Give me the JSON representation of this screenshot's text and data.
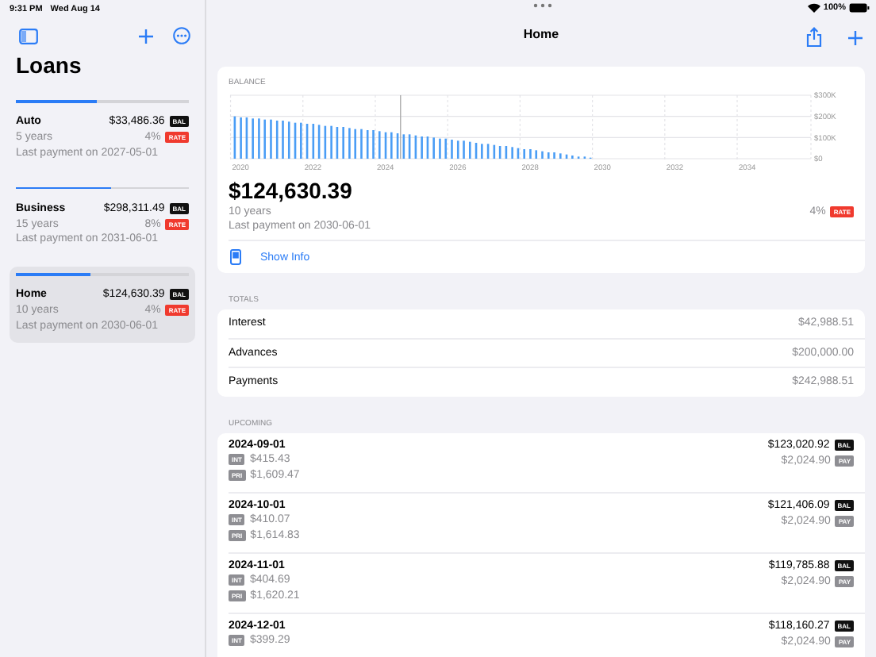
{
  "status_bar": {
    "time": "9:31 PM",
    "date": "Wed Aug 14",
    "battery": "100%"
  },
  "sidebar": {
    "title": "Loans",
    "loans": [
      {
        "name": "Auto",
        "balance": "$33,486.36",
        "balance_badge": "BAL",
        "term": "5 years",
        "rate": "4%",
        "rate_badge": "RATE",
        "last_payment": "Last payment on 2027-05-01",
        "level": 0.47,
        "selected": false
      },
      {
        "name": "Business",
        "balance": "$298,311.49",
        "balance_badge": "BAL",
        "term": "15 years",
        "rate": "8%",
        "rate_badge": "RATE",
        "last_payment": "Last payment on 2031-06-01",
        "level": 0.55,
        "selected": false
      },
      {
        "name": "Home",
        "balance": "$124,630.39",
        "balance_badge": "BAL",
        "term": "10 years",
        "rate": "4%",
        "rate_badge": "RATE",
        "last_payment": "Last payment on 2030-06-01",
        "level": 0.43,
        "selected": true
      }
    ]
  },
  "detail": {
    "title": "Home",
    "balance_card": {
      "label": "BALANCE",
      "chart_data": {
        "type": "bar",
        "x": [
          2020,
          2020.17,
          2020.33,
          2020.5,
          2020.67,
          2020.83,
          2021,
          2021.17,
          2021.33,
          2021.5,
          2021.67,
          2021.83,
          2022,
          2022.17,
          2022.33,
          2022.5,
          2022.67,
          2022.83,
          2023,
          2023.17,
          2023.33,
          2023.5,
          2023.67,
          2023.83,
          2024,
          2024.17,
          2024.33,
          2024.5,
          2024.67,
          2024.83,
          2025,
          2025.17,
          2025.33,
          2025.5,
          2025.67,
          2025.83,
          2026,
          2026.17,
          2026.33,
          2026.5,
          2026.67,
          2026.83,
          2027,
          2027.17,
          2027.33,
          2027.5,
          2027.67,
          2027.83,
          2028,
          2028.17,
          2028.33,
          2028.5,
          2028.67,
          2028.83,
          2029,
          2029.17,
          2029.33,
          2029.5,
          2029.67,
          2029.83
        ],
        "series": [
          {
            "color": "#4a9df5",
            "values": [
              200000,
              195000,
              195000,
              190000,
              190000,
              185000,
              185000,
              180000,
              180000,
              175000,
              170000,
              170000,
              165000,
              165000,
              160000,
              155000,
              155000,
              150000,
              150000,
              145000,
              140000,
              140000,
              135000,
              135000,
              130000,
              125000,
              125000,
              120000,
              115000,
              115000,
              110000,
              105000,
              105000,
              100000,
              95000,
              95000,
              90000,
              85000,
              85000,
              80000,
              75000,
              70000,
              70000,
              65000,
              60000,
              60000,
              55000,
              50000,
              45000,
              45000,
              40000,
              35000,
              30000,
              30000,
              25000,
              20000,
              15000,
              10000,
              10000,
              5000
            ]
          }
        ],
        "xlim": [
          2019.9,
          2035.6
        ],
        "ylim": [
          0,
          300000
        ],
        "xticks": [
          2020,
          2022,
          2024,
          2026,
          2028,
          2030,
          2032,
          2034
        ],
        "yticks": [
          {
            "value": 0,
            "label": "$0"
          },
          {
            "value": 100000,
            "label": "$100K"
          },
          {
            "value": 200000,
            "label": "$200K"
          },
          {
            "value": 300000,
            "label": "$300K"
          }
        ]
      },
      "amount": "$124,630.39",
      "term": "10 years",
      "rate": "4%",
      "rate_badge": "RATE",
      "last_payment": "Last payment on 2030-06-01",
      "show_info": "Show Info"
    },
    "totals": {
      "label": "TOTALS",
      "rows": [
        {
          "name": "Interest",
          "value": "$42,988.51"
        },
        {
          "name": "Advances",
          "value": "$200,000.00"
        },
        {
          "name": "Payments",
          "value": "$242,988.51"
        }
      ]
    },
    "upcoming": {
      "label": "UPCOMING",
      "rows": [
        {
          "date": "2024-09-01",
          "interest_badge": "INT",
          "interest": "$415.43",
          "principal_badge": "PRI",
          "principal": "$1,609.47",
          "balance": "$123,020.92",
          "balance_badge": "BAL",
          "payment": "$2,024.90",
          "payment_badge": "PAY"
        },
        {
          "date": "2024-10-01",
          "interest_badge": "INT",
          "interest": "$410.07",
          "principal_badge": "PRI",
          "principal": "$1,614.83",
          "balance": "$121,406.09",
          "balance_badge": "BAL",
          "payment": "$2,024.90",
          "payment_badge": "PAY"
        },
        {
          "date": "2024-11-01",
          "interest_badge": "INT",
          "interest": "$404.69",
          "principal_badge": "PRI",
          "principal": "$1,620.21",
          "balance": "$119,785.88",
          "balance_badge": "BAL",
          "payment": "$2,024.90",
          "payment_badge": "PAY"
        },
        {
          "date": "2024-12-01",
          "interest_badge": "INT",
          "interest": "$399.29",
          "balance": "$118,160.27",
          "balance_badge": "BAL",
          "payment": "$2,024.90",
          "payment_badge": "PAY"
        }
      ]
    }
  }
}
